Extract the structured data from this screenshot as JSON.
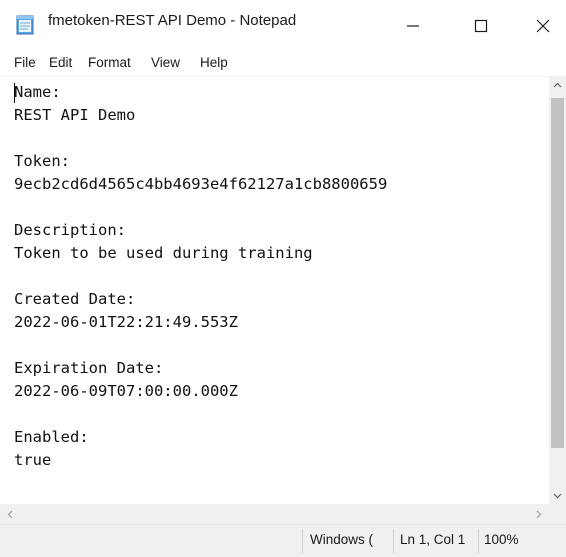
{
  "window": {
    "title": "fmetoken-REST API Demo - Notepad",
    "icons": {
      "app": "notepad-icon",
      "minimize": "minimize-icon",
      "maximize": "maximize-icon",
      "close": "close-icon"
    }
  },
  "menu": {
    "items": [
      {
        "label": "File"
      },
      {
        "label": "Edit"
      },
      {
        "label": "Format"
      },
      {
        "label": "View"
      },
      {
        "label": "Help"
      }
    ]
  },
  "document": {
    "lines": [
      "Name:",
      "REST API Demo",
      "",
      "Token:",
      "9ecb2cd6d4565c4bb4693e4f62127a1cb8800659",
      "",
      "Description:",
      "Token to be used during training",
      "",
      "Created Date:",
      "2022-06-01T22:21:49.553Z",
      "",
      "Expiration Date:",
      "2022-06-09T07:00:00.000Z",
      "",
      "Enabled:",
      "true"
    ]
  },
  "statusbar": {
    "encoding": "Windows (",
    "position": "Ln 1, Col 1",
    "zoom": "100%"
  },
  "colors": {
    "titlebar_bg": "#ffffff",
    "statusbar_bg": "#f0f0f0",
    "scroll_thumb": "#c2c2c2"
  }
}
